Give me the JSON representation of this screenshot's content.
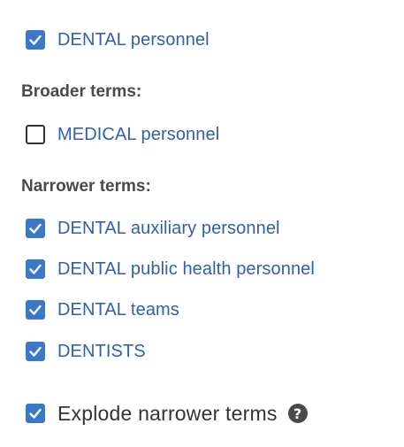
{
  "term": {
    "label": "DENTAL personnel",
    "checked": true
  },
  "broader": {
    "heading": "Broader terms:",
    "items": [
      {
        "label": "MEDICAL personnel",
        "checked": false
      }
    ]
  },
  "narrower": {
    "heading": "Narrower terms:",
    "items": [
      {
        "label": "DENTAL auxiliary personnel",
        "checked": true
      },
      {
        "label": "DENTAL public health personnel",
        "checked": true
      },
      {
        "label": "DENTAL teams",
        "checked": true
      },
      {
        "label": "DENTISTS",
        "checked": true
      }
    ]
  },
  "explode": {
    "label": "Explode narrower terms",
    "checked": true,
    "help_icon": "question-circle-icon",
    "help_glyph": "?"
  },
  "colors": {
    "checkbox_checked": "#3a78c9",
    "link": "#2f5fae",
    "heading": "#4a4a4a",
    "text": "#333333"
  }
}
